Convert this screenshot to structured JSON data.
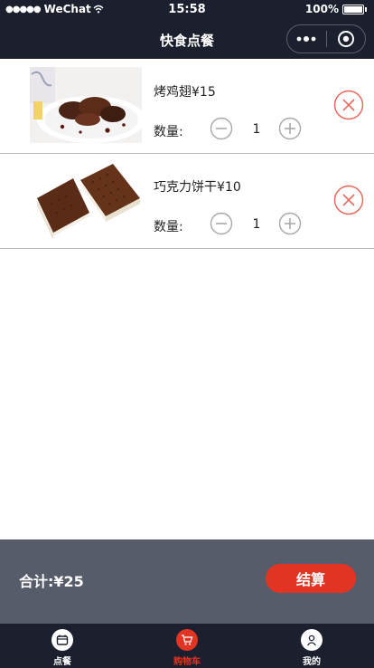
{
  "status_bar": {
    "carrier": "WeChat",
    "time": "15:58",
    "battery": "100%"
  },
  "nav": {
    "title": "快食点餐"
  },
  "cart": {
    "items": [
      {
        "name": "烤鸡翅",
        "price": "¥15",
        "qty_label": "数量:",
        "qty": "1",
        "image": "grilled-chicken-wings"
      },
      {
        "name": "巧克力饼干",
        "price": "¥10",
        "qty_label": "数量:",
        "qty": "1",
        "image": "chocolate-ice-cream-sandwich"
      }
    ]
  },
  "summary": {
    "total_label": "合计:¥25",
    "checkout_label": "结算"
  },
  "tabs": [
    {
      "label": "点餐",
      "icon": "menu-icon",
      "active": false
    },
    {
      "label": "购物车",
      "icon": "cart-icon",
      "active": true
    },
    {
      "label": "我的",
      "icon": "profile-icon",
      "active": false
    }
  ],
  "colors": {
    "nav_bg": "#1b1f2e",
    "summary_bg": "#575c6a",
    "accent": "#e23423",
    "remove": "#e86a5f"
  }
}
